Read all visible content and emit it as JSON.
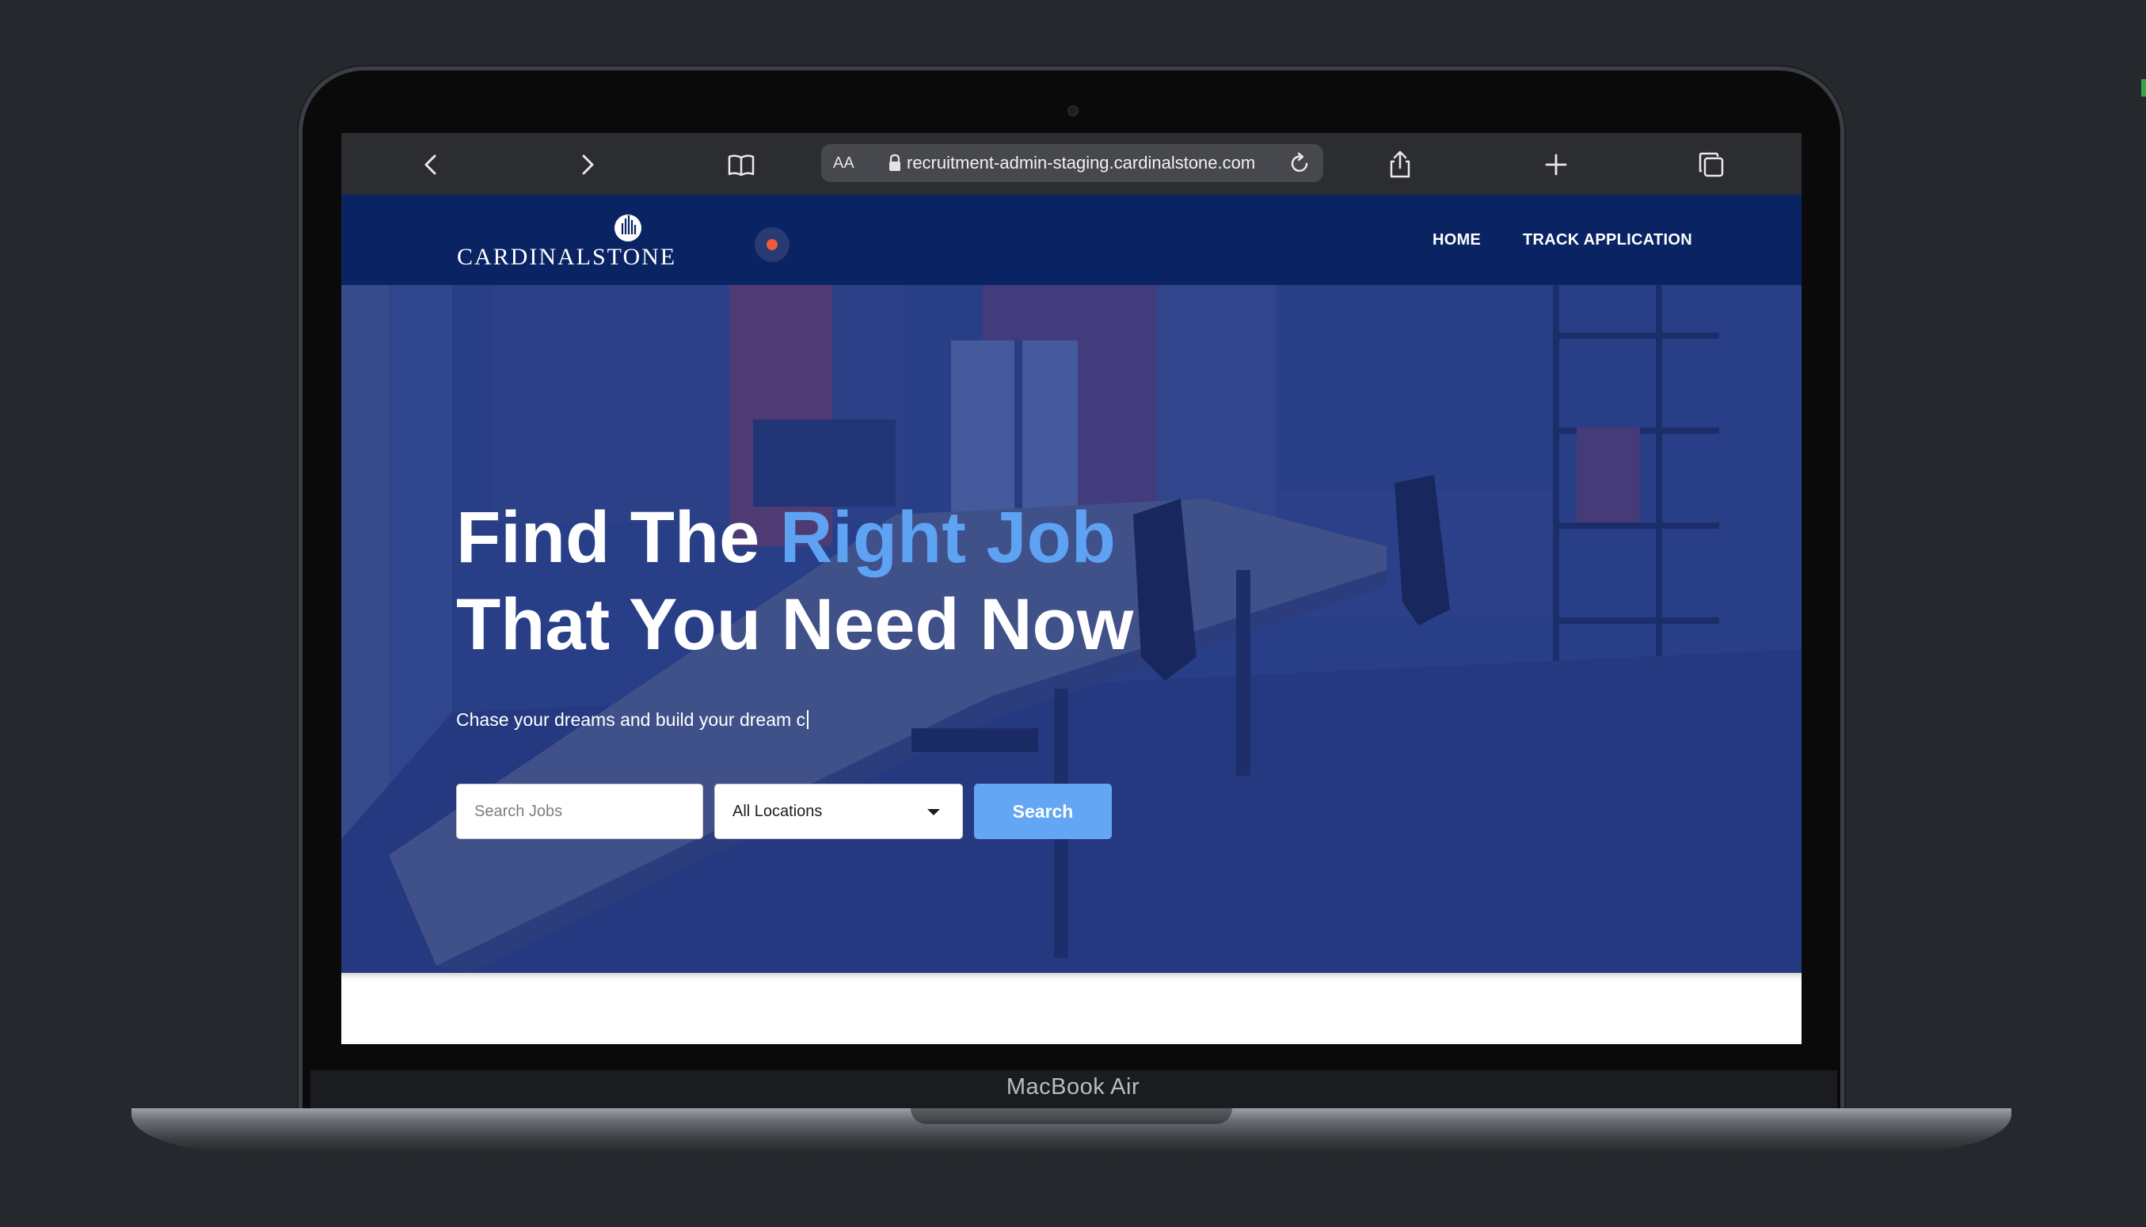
{
  "browser": {
    "text_size_label": "AA",
    "url": "recruitment-admin-staging.cardinalstone.com"
  },
  "site": {
    "logo_text": "CARDINALSTONE",
    "nav": [
      "HOME",
      "TRACK APPLICATION"
    ]
  },
  "hero": {
    "title_part1": "Find The ",
    "title_accent": "Right Job",
    "title_line2": "That You Need Now",
    "subtitle": "Chase your dreams and build your dream c",
    "search_placeholder": "Search Jobs",
    "location_selected": "All Locations",
    "search_button": "Search"
  },
  "device": {
    "label": "MacBook Air"
  },
  "colors": {
    "page_background": "#25282d",
    "site_header": "#0a2463",
    "accent": "#5ea2f3",
    "button": "#63a6f4"
  },
  "icons": [
    "back-icon",
    "forward-icon",
    "bookmarks-icon",
    "lock-icon",
    "reload-icon",
    "share-icon",
    "new-tab-icon",
    "tabs-icon",
    "chevron-down-icon"
  ]
}
